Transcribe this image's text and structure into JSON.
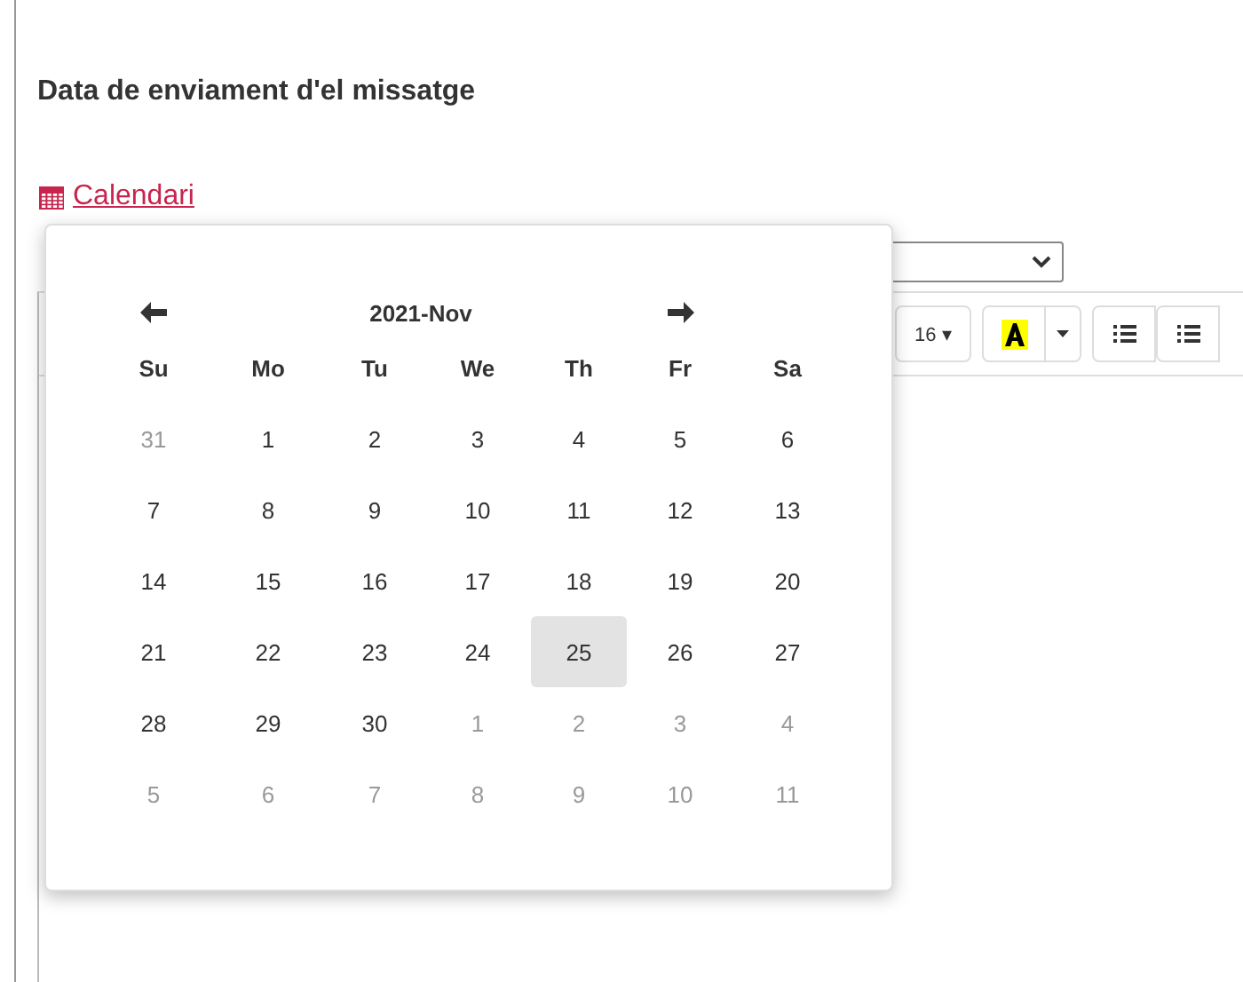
{
  "heading": "Data de enviament d'el missatge",
  "calendar_link": "Calendari",
  "toolbar": {
    "font_size": "16 ▾"
  },
  "datepicker": {
    "title": "2021-Nov",
    "weekdays": [
      "Su",
      "Mo",
      "Tu",
      "We",
      "Th",
      "Fr",
      "Sa"
    ],
    "weeks": [
      [
        {
          "label": "31",
          "muted": true,
          "selected": false
        },
        {
          "label": "1",
          "muted": false,
          "selected": false
        },
        {
          "label": "2",
          "muted": false,
          "selected": false
        },
        {
          "label": "3",
          "muted": false,
          "selected": false
        },
        {
          "label": "4",
          "muted": false,
          "selected": false
        },
        {
          "label": "5",
          "muted": false,
          "selected": false
        },
        {
          "label": "6",
          "muted": false,
          "selected": false
        }
      ],
      [
        {
          "label": "7",
          "muted": false,
          "selected": false
        },
        {
          "label": "8",
          "muted": false,
          "selected": false
        },
        {
          "label": "9",
          "muted": false,
          "selected": false
        },
        {
          "label": "10",
          "muted": false,
          "selected": false
        },
        {
          "label": "11",
          "muted": false,
          "selected": false
        },
        {
          "label": "12",
          "muted": false,
          "selected": false
        },
        {
          "label": "13",
          "muted": false,
          "selected": false
        }
      ],
      [
        {
          "label": "14",
          "muted": false,
          "selected": false
        },
        {
          "label": "15",
          "muted": false,
          "selected": false
        },
        {
          "label": "16",
          "muted": false,
          "selected": false
        },
        {
          "label": "17",
          "muted": false,
          "selected": false
        },
        {
          "label": "18",
          "muted": false,
          "selected": false
        },
        {
          "label": "19",
          "muted": false,
          "selected": false
        },
        {
          "label": "20",
          "muted": false,
          "selected": false
        }
      ],
      [
        {
          "label": "21",
          "muted": false,
          "selected": false
        },
        {
          "label": "22",
          "muted": false,
          "selected": false
        },
        {
          "label": "23",
          "muted": false,
          "selected": false
        },
        {
          "label": "24",
          "muted": false,
          "selected": false
        },
        {
          "label": "25",
          "muted": false,
          "selected": true
        },
        {
          "label": "26",
          "muted": false,
          "selected": false
        },
        {
          "label": "27",
          "muted": false,
          "selected": false
        }
      ],
      [
        {
          "label": "28",
          "muted": false,
          "selected": false
        },
        {
          "label": "29",
          "muted": false,
          "selected": false
        },
        {
          "label": "30",
          "muted": false,
          "selected": false
        },
        {
          "label": "1",
          "muted": true,
          "selected": false
        },
        {
          "label": "2",
          "muted": true,
          "selected": false
        },
        {
          "label": "3",
          "muted": true,
          "selected": false
        },
        {
          "label": "4",
          "muted": true,
          "selected": false
        }
      ],
      [
        {
          "label": "5",
          "muted": true,
          "selected": false
        },
        {
          "label": "6",
          "muted": true,
          "selected": false
        },
        {
          "label": "7",
          "muted": true,
          "selected": false
        },
        {
          "label": "8",
          "muted": true,
          "selected": false
        },
        {
          "label": "9",
          "muted": true,
          "selected": false
        },
        {
          "label": "10",
          "muted": true,
          "selected": false
        },
        {
          "label": "11",
          "muted": true,
          "selected": false
        }
      ]
    ]
  }
}
